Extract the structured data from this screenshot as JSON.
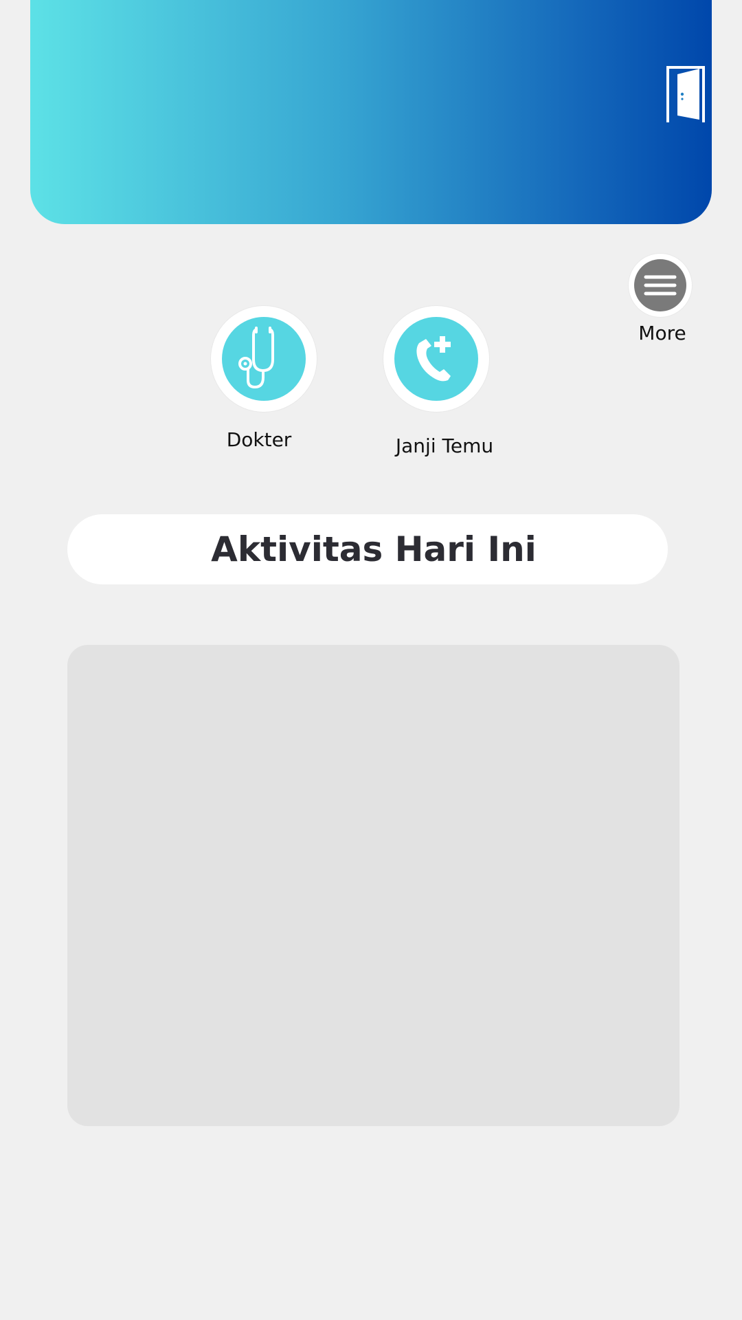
{
  "header": {
    "logout_icon": "door-open-icon",
    "gradient_colors": [
      "#5de1e6",
      "#0047ab"
    ]
  },
  "menu": {
    "items": [
      {
        "id": "dokter",
        "label": "Dokter",
        "icon": "stethoscope-icon"
      },
      {
        "id": "janji-temu",
        "label": "Janji Temu",
        "icon": "phone-plus-icon"
      },
      {
        "id": "more",
        "label": "More",
        "icon": "hamburger-menu-icon"
      }
    ],
    "accent_color": "#56d6e2",
    "more_color": "#7a7a7a"
  },
  "activity": {
    "title": "Aktivitas Hari Ini"
  }
}
